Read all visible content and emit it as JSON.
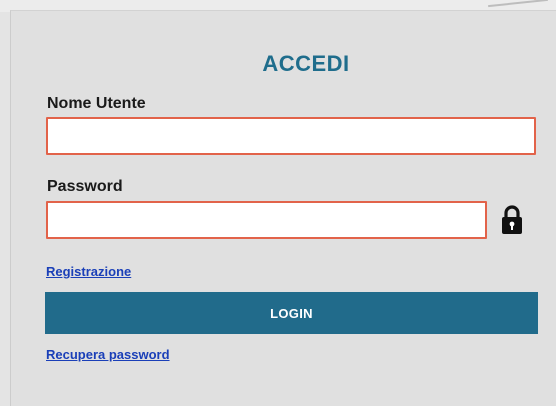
{
  "login_form": {
    "title": "ACCEDI",
    "username_label": "Nome Utente",
    "username_value": "",
    "password_label": "Password",
    "password_value": "",
    "register_link": "Registrazione",
    "login_button": "LOGIN",
    "recover_link": "Recupera password"
  },
  "icons": {
    "password_icon": "lock-icon"
  },
  "colors": {
    "title": "#1f6d8c",
    "button_bg": "#216b8b",
    "field_border": "#e2634a",
    "link": "#1a3fb8",
    "background": "#e0e0e0"
  }
}
